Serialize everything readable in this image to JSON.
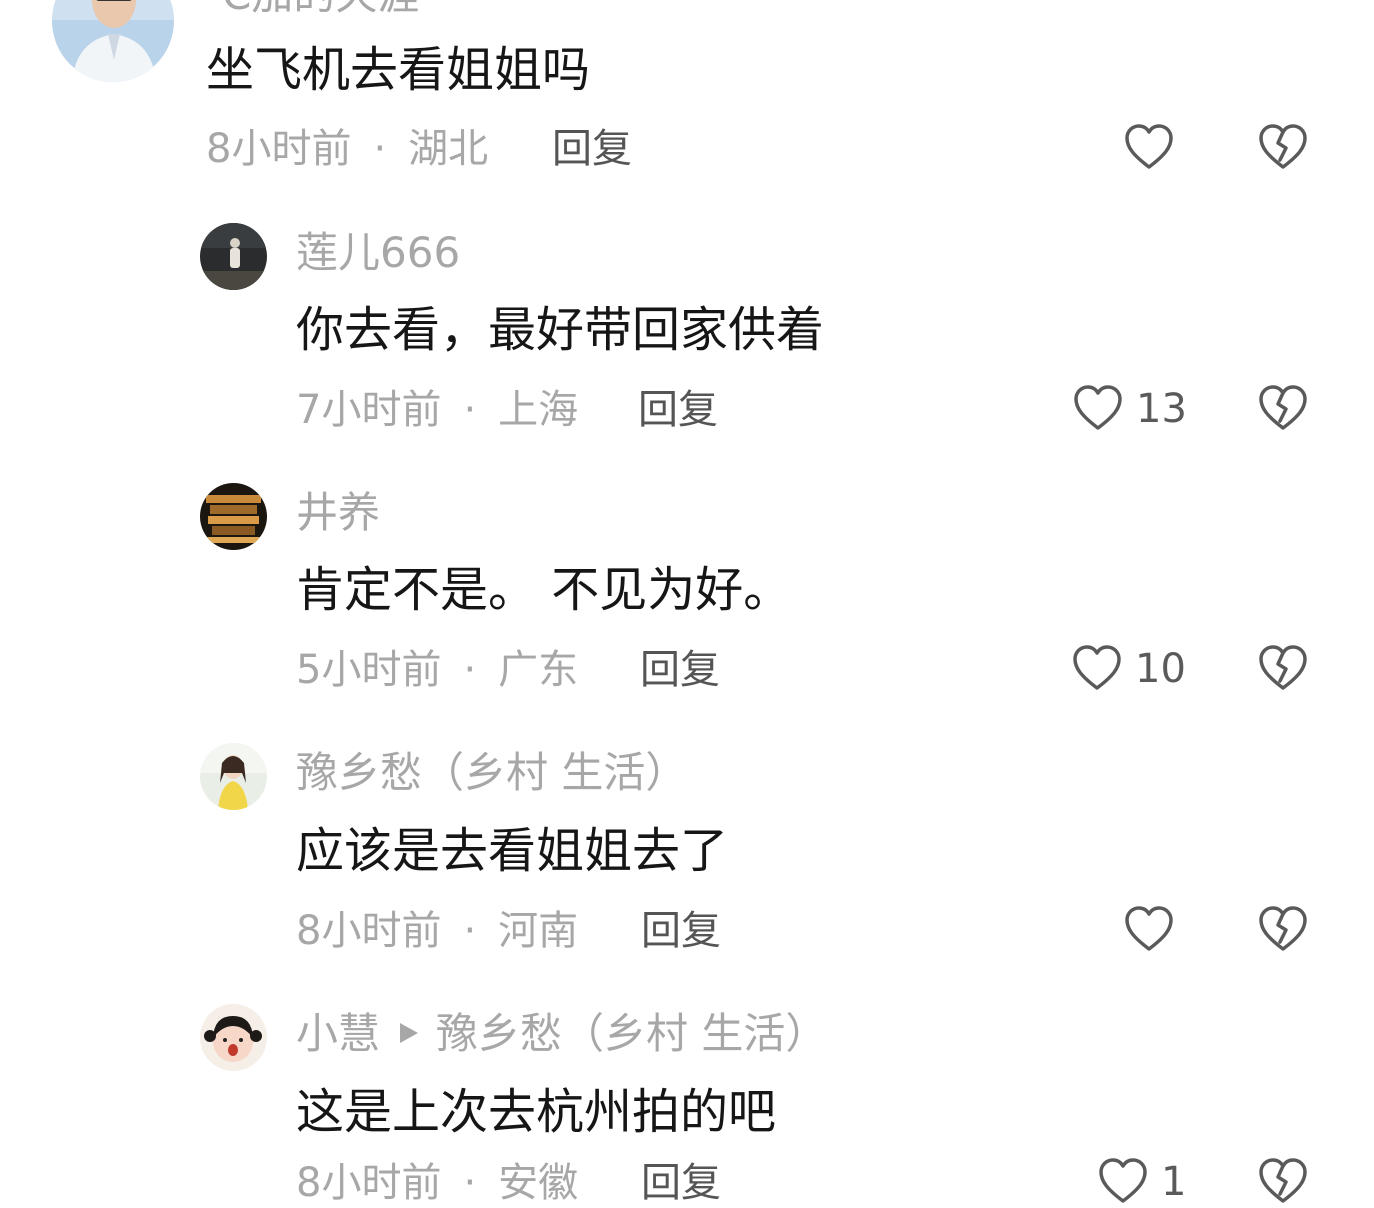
{
  "comments": [
    {
      "username": "C加的天涯",
      "content": "坐飞机去看姐姐吗",
      "time": "8小时前",
      "location": "湖北",
      "reply_label": "回复",
      "like_count": ""
    },
    {
      "username": "莲儿666",
      "content": "你去看，最好带回家供着",
      "time": "7小时前",
      "location": "上海",
      "reply_label": "回复",
      "like_count": "13"
    },
    {
      "username": "井养",
      "content": "肯定不是。 不见为好。",
      "time": "5小时前",
      "location": "广东",
      "reply_label": "回复",
      "like_count": "10"
    },
    {
      "username": "豫乡愁（乡村 生活）",
      "content": "应该是去看姐姐去了",
      "time": "8小时前",
      "location": "河南",
      "reply_label": "回复",
      "like_count": ""
    },
    {
      "username": "小慧",
      "reply_to": "豫乡愁（乡村 生活）",
      "content": "这是上次去杭州拍的吧",
      "time": "8小时前",
      "location": "安徽",
      "reply_label": "回复",
      "like_count": "1"
    }
  ],
  "separator_dot": "·",
  "icons": {
    "like": "heart-outline-icon",
    "dislike": "broken-heart-icon"
  },
  "colors": {
    "text_primary": "#161616",
    "text_secondary": "#a7a7a7",
    "reply": "#555555",
    "icon": "#5a5a5a"
  }
}
